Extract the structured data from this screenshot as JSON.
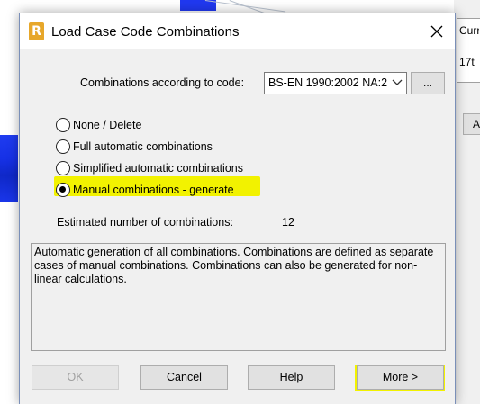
{
  "background": {
    "panel_text_1": "Curr",
    "panel_text_2": "17t",
    "button_label": "A"
  },
  "dialog": {
    "title": "Load Case Code Combinations",
    "app_icon_letter": "R",
    "code": {
      "label": "Combinations according to code:",
      "selected": "BS-EN 1990:2002 NA:2",
      "browse_label": "..."
    },
    "options": [
      {
        "label": "None / Delete",
        "checked": false
      },
      {
        "label": "Full automatic combinations",
        "checked": false
      },
      {
        "label": "Simplified automatic combinations",
        "checked": false
      },
      {
        "label": "Manual combinations - generate",
        "checked": true
      }
    ],
    "estimate": {
      "label": "Estimated number of combinations:",
      "value": "12"
    },
    "description": "Automatic generation of all combinations. Combinations are defined as separate cases of manual combinations. Combinations can also be generated for non-linear calculations.",
    "buttons": {
      "ok": "OK",
      "cancel": "Cancel",
      "help": "Help",
      "more": "More >"
    }
  },
  "colors": {
    "highlight": "#f2f200",
    "dialog_bg": "#f0f0f0",
    "background_blue": "#1f3cf0"
  }
}
